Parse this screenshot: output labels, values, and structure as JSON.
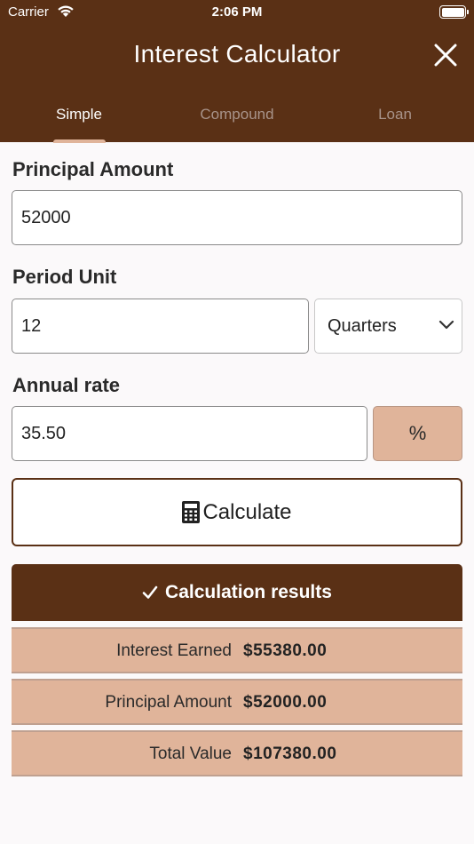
{
  "status_bar": {
    "carrier": "Carrier",
    "time": "2:06 PM"
  },
  "header": {
    "title": "Interest Calculator",
    "close_icon": "close-icon"
  },
  "tabs": [
    {
      "label": "Simple",
      "active": true
    },
    {
      "label": "Compound",
      "active": false
    },
    {
      "label": "Loan",
      "active": false
    }
  ],
  "form": {
    "principal_label": "Principal Amount",
    "principal_value": "52000",
    "period_label": "Period Unit",
    "period_value": "12",
    "period_unit": "Quarters",
    "rate_label": "Annual rate",
    "rate_value": "35.50",
    "rate_suffix": "%"
  },
  "calculate": {
    "label": "Calculate",
    "icon": "calculator-icon"
  },
  "results": {
    "title": "Calculation results",
    "icon": "checkmark-icon",
    "rows": [
      {
        "label": "Interest Earned",
        "value": "$55380.00"
      },
      {
        "label": "Principal Amount",
        "value": "$52000.00"
      },
      {
        "label": "Total Value",
        "value": "$107380.00"
      }
    ]
  },
  "colors": {
    "brand": "#5a3015",
    "accent": "#e0b49a",
    "background": "#fbf9fa"
  }
}
